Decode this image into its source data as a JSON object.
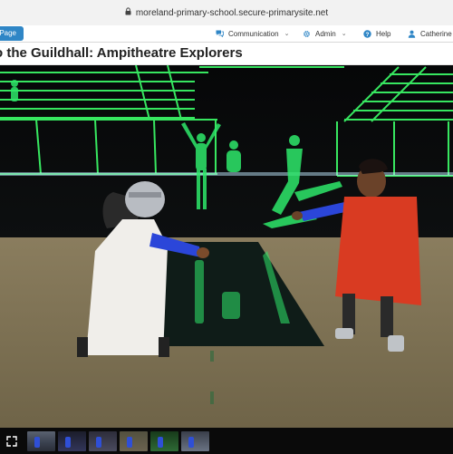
{
  "browser": {
    "url": "moreland-primary-school.secure-primarysite.net"
  },
  "nav": {
    "home_label": "Home Page",
    "items": [
      {
        "label": "Communication",
        "icon": "chat-icon"
      },
      {
        "label": "Admin",
        "icon": "gear-icon"
      },
      {
        "label": "Help",
        "icon": "question-icon"
      },
      {
        "label": "Catherine I",
        "icon": "user-icon"
      }
    ]
  },
  "page": {
    "title": "o the Guildhall: Ampitheatre Explorers"
  },
  "gallery": {
    "expand_icon": "expand-icon",
    "thumbnail_count": 6
  },
  "colors": {
    "nav_accent": "#2f86c6",
    "neon_green": "#3dff6a"
  }
}
